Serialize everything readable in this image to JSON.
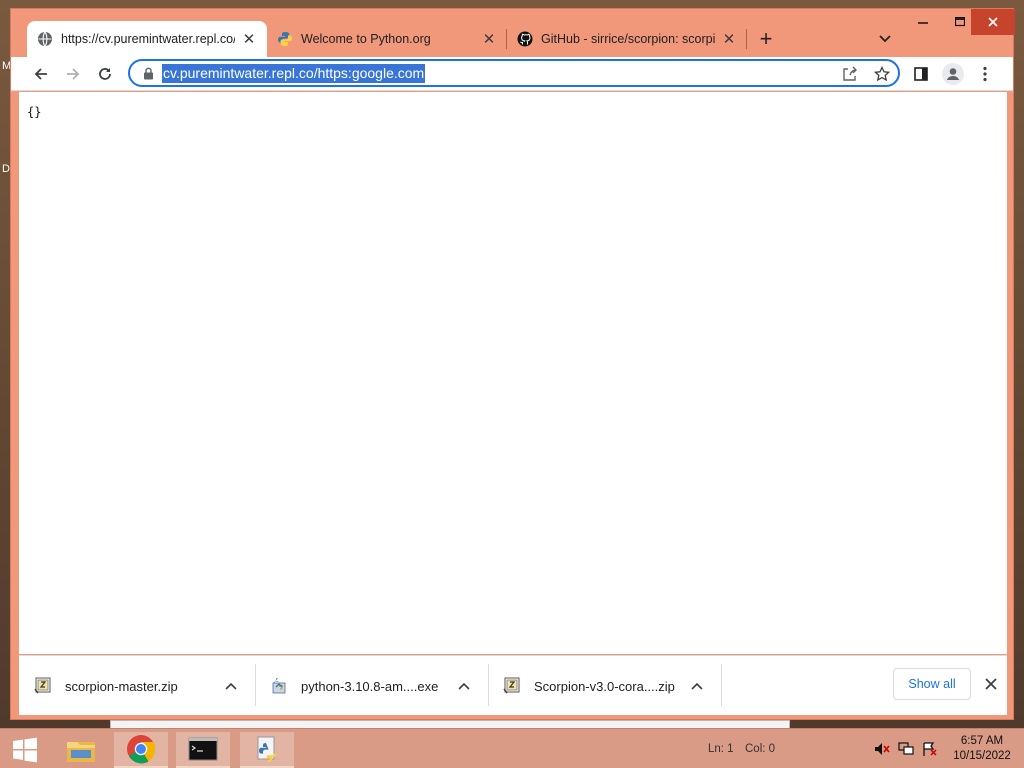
{
  "desktop": {
    "letters": [
      "M",
      "D"
    ]
  },
  "browser": {
    "tabs": [
      {
        "title": "https://cv.puremintwater.repl.co/https:google.com",
        "icon": "globe-icon",
        "active": true
      },
      {
        "title": "Welcome to Python.org",
        "icon": "python-logo-icon",
        "active": false
      },
      {
        "title": "GitHub - sirrice/scorpion: scorpion",
        "icon": "github-icon",
        "active": false
      }
    ],
    "new_tab_label": "+",
    "omnibox": {
      "url": "cv.puremintwater.repl.co/https:google.com"
    },
    "page_body": "{}",
    "downloads": [
      {
        "name": "scorpion-master.zip",
        "icon": "zip-file-icon"
      },
      {
        "name": "python-3.10.8-am....exe",
        "icon": "python-installer-icon"
      },
      {
        "name": "Scorpion-v3.0-cora....zip",
        "icon": "zip-file-icon"
      }
    ],
    "show_all_label": "Show all"
  },
  "taskbar": {
    "apps": [
      "file-explorer-icon",
      "chrome-icon",
      "command-prompt-icon",
      "python-icon"
    ],
    "status": {
      "line": "Ln: 1",
      "col": "Col: 0"
    },
    "clock": {
      "time": "6:57 AM",
      "date": "10/15/2022"
    }
  },
  "colors": {
    "accent": "#1a73e8",
    "frame": "#f2987a",
    "selection": "#3875d7"
  }
}
